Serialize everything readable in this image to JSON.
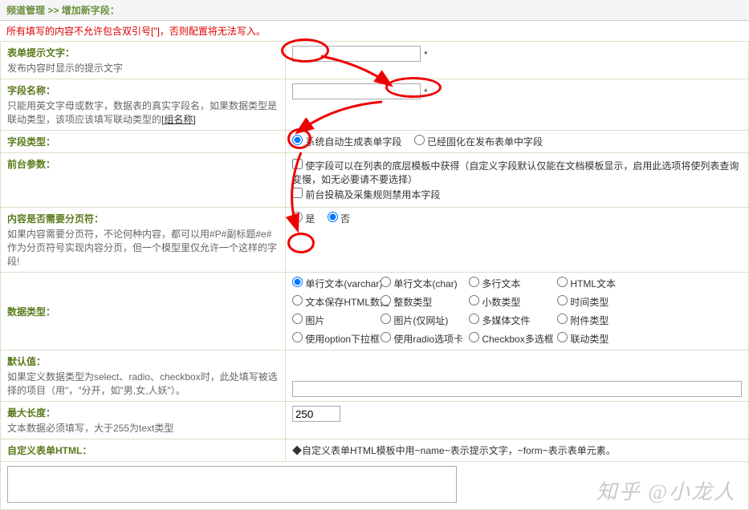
{
  "breadcrumb": {
    "a": "频道管理",
    "sep": " >> ",
    "b": "增加新字段："
  },
  "warning": "所有填写的内容不允许包含双引号[\"]，否则配置将无法写入。",
  "rows": {
    "hint": {
      "title": "表单提示文字：",
      "desc": "发布内容时显示的提示文字",
      "value": "",
      "star": "*"
    },
    "fieldname": {
      "title": "字段名称：",
      "desc": "只能用英文字母或数字，数据表的真实字段名，如果数据类型是联动类型，该项应该填写联动类型的",
      "link": "[组名称]",
      "value": "",
      "star": "*"
    },
    "fieldtype": {
      "title": "字段类型：",
      "opt1": "系统自动生成表单字段",
      "opt2": "已经固化在发布表单中字段"
    },
    "frontparam": {
      "title": "前台参数：",
      "cb1": "使字段可以在列表的底层模板中获得（自定义字段默认仅能在文档模板显示，启用此选项将使列表查询变慢，如无必要请不要选择）",
      "cb2": "前台投稿及采集规则禁用本字段"
    },
    "pageflag": {
      "title": "内容是否需要分页符：",
      "desc": "如果内容需要分页符，不论何种内容，都可以用#P#副标题#e#作为分页符号实现内容分页，但一个模型里仅允许一个这样的字段!",
      "yes": "是",
      "no": "否"
    },
    "datatype": {
      "title": "数据类型：",
      "r1": "单行文本(varchar)",
      "r2": "单行文本(char)",
      "r3": "多行文本",
      "r4": "HTML文本",
      "r5": "文本保存HTML数据",
      "r6": "整数类型",
      "r7": "小数类型",
      "r8": "时间类型",
      "r9": "图片",
      "r10": "图片(仅网址)",
      "r11": "多媒体文件",
      "r12": "附件类型",
      "r13": "使用option下拉框",
      "r14": "使用radio选项卡",
      "r15": "Checkbox多选框",
      "r16": "联动类型"
    },
    "default": {
      "title": "默认值：",
      "desc": "如果定义数据类型为select、radio、checkbox时，此处填写被选择的项目（用\"，\"分开，如\"男,女,人妖\"）。"
    },
    "maxlen": {
      "title": "最大长度：",
      "desc": "文本数据必须填写，大于255为text类型",
      "value": "250"
    },
    "customhtml": {
      "title": "自定义表单HTML：",
      "note": "◆自定义表单HTML模板中用~name~表示提示文字，~form~表示表单元素。"
    }
  },
  "watermark": "知乎 @小龙人"
}
